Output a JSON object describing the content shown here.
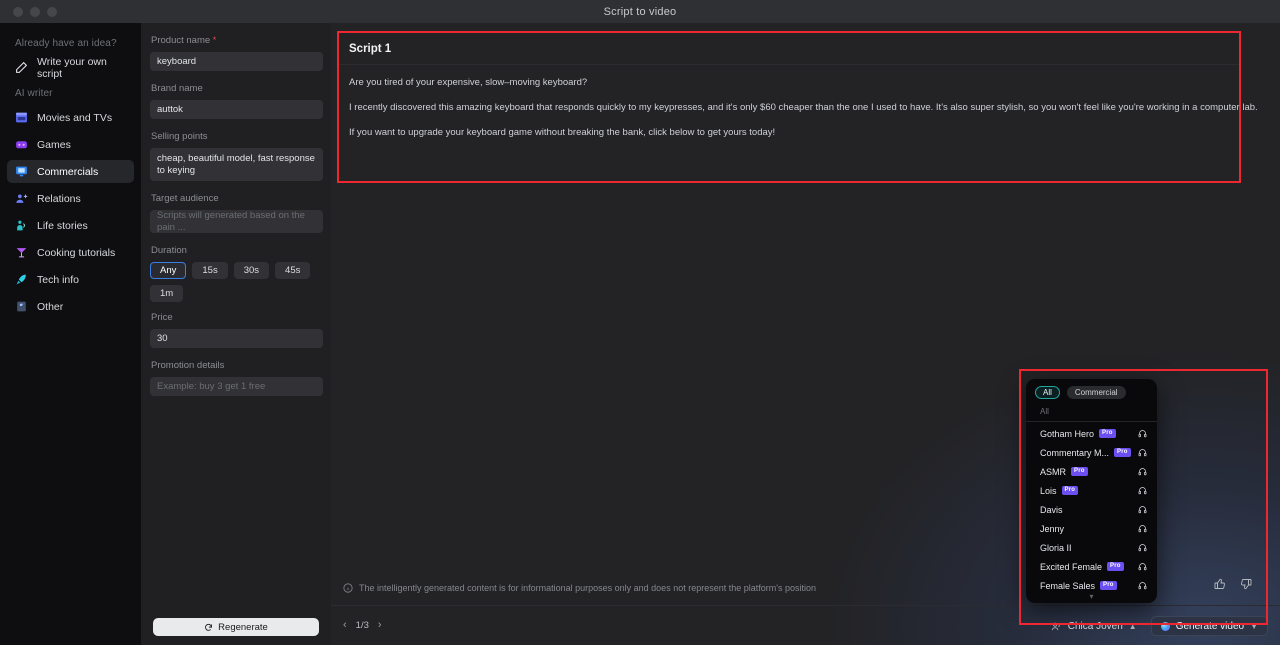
{
  "window": {
    "title": "Script to video",
    "traffic_lights": [
      "close",
      "minimize",
      "zoom"
    ]
  },
  "sidebar": {
    "group1_label": "Already have an idea?",
    "own_script": {
      "label": "Write your own script",
      "icon": "pencil-icon"
    },
    "group2_label": "AI writer",
    "items": [
      {
        "label": "Movies and TVs",
        "icon": "clapperboard-icon",
        "active": false
      },
      {
        "label": "Games",
        "icon": "game-console-icon",
        "active": false
      },
      {
        "label": "Commercials",
        "icon": "monitor-icon",
        "active": true
      },
      {
        "label": "Relations",
        "icon": "people-icon",
        "active": false
      },
      {
        "label": "Life stories",
        "icon": "person-wave-icon",
        "active": false
      },
      {
        "label": "Cooking tutorials",
        "icon": "cocktail-icon",
        "active": false
      },
      {
        "label": "Tech info",
        "icon": "rocket-icon",
        "active": false
      },
      {
        "label": "Other",
        "icon": "flag-icon",
        "active": false
      }
    ]
  },
  "form": {
    "product_name": {
      "label": "Product name",
      "required": true,
      "value": "keyboard"
    },
    "brand_name": {
      "label": "Brand name",
      "value": "auttok"
    },
    "selling_points": {
      "label": "Selling points",
      "value": "cheap, beautiful model, fast response to keying"
    },
    "target_audience": {
      "label": "Target audience",
      "value": "",
      "placeholder": "Scripts will generated based on the pain ..."
    },
    "duration": {
      "label": "Duration",
      "options": [
        "Any",
        "15s",
        "30s",
        "45s",
        "1m"
      ],
      "selected": "Any"
    },
    "price": {
      "label": "Price",
      "value": "30"
    },
    "promotion_details": {
      "label": "Promotion details",
      "value": "",
      "placeholder": "Example: buy 3 get 1 free"
    },
    "regenerate_button": {
      "label": "Regenerate",
      "icon": "refresh-icon"
    }
  },
  "script": {
    "title": "Script 1",
    "paragraphs": [
      "Are you tired of your expensive, slow–moving keyboard?",
      "I recently discovered this amazing keyboard that responds quickly to my keypresses, and it's only $60 cheaper than the one I used to have. It's also super stylish, so you won't feel like you're working in a computer lab.",
      "If you want to upgrade your keyboard game without breaking the bank, click below to get yours today!"
    ]
  },
  "footer": {
    "disclaimer": "The intelligently generated content is for informational purposes only and does not represent the platform's position",
    "disclaimer_icon": "info-icon",
    "pagination": {
      "prev_icon": "chevron-left-icon",
      "label": "1/3",
      "next_icon": "chevron-right-icon"
    },
    "thumbs_up_icon": "thumbs-up-icon",
    "thumbs_down_icon": "thumbs-down-icon"
  },
  "voice_panel": {
    "tabs": [
      {
        "label": "All",
        "selected": true
      },
      {
        "label": "Commercial",
        "selected": false
      }
    ],
    "section_label": "All",
    "items": [
      {
        "name": "Gotham Hero",
        "pro": true,
        "pro_label": "Pro",
        "icon": "headphones-icon"
      },
      {
        "name": "Commentary M...",
        "pro": true,
        "pro_label": "Pro",
        "icon": "headphones-icon"
      },
      {
        "name": "ASMR",
        "pro": true,
        "pro_label": "Pro",
        "icon": "headphones-icon"
      },
      {
        "name": "Lois",
        "pro": true,
        "pro_label": "Pro",
        "icon": "headphones-icon"
      },
      {
        "name": "Davis",
        "pro": false,
        "pro_label": "",
        "icon": "headphones-icon"
      },
      {
        "name": "Jenny",
        "pro": false,
        "pro_label": "",
        "icon": "headphones-icon"
      },
      {
        "name": "Gloria II",
        "pro": false,
        "pro_label": "",
        "icon": "headphones-icon"
      },
      {
        "name": "Excited Female",
        "pro": true,
        "pro_label": "Pro",
        "icon": "headphones-icon"
      },
      {
        "name": "Female Sales",
        "pro": true,
        "pro_label": "Pro",
        "icon": "headphones-icon"
      }
    ],
    "more_icon": "chevron-down-icon"
  },
  "action_bar": {
    "voice_selector": {
      "label": "Chica Joven",
      "icon": "voice-person-icon",
      "caret": "chevron-up-icon"
    },
    "generate_button": {
      "label": "Generate video",
      "caret": "chevron-down-icon"
    }
  },
  "colors": {
    "accent_red": "#ef2730",
    "accent_blue": "#3b7de0",
    "accent_teal": "#21a89c",
    "pro_purple": "#6c4ff0"
  }
}
